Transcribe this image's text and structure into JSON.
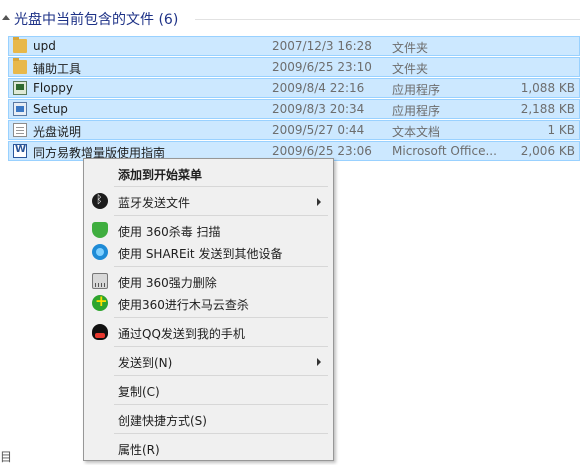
{
  "group": {
    "title": "光盘中当前包含的文件 (6)"
  },
  "files": [
    {
      "name": "upd",
      "date": "2007/12/3 16:28",
      "type": "文件夹",
      "size": "",
      "icon": "folder-icon"
    },
    {
      "name": "辅助工具",
      "date": "2009/6/25 23:10",
      "type": "文件夹",
      "size": "",
      "icon": "folder-icon"
    },
    {
      "name": "Floppy",
      "date": "2009/8/4 22:16",
      "type": "应用程序",
      "size": "1,088 KB",
      "icon": "application-icon"
    },
    {
      "name": "Setup",
      "date": "2009/8/3 20:34",
      "type": "应用程序",
      "size": "2,188 KB",
      "icon": "setup-icon"
    },
    {
      "name": "光盘说明",
      "date": "2009/5/27 0:44",
      "type": "文本文档",
      "size": "1 KB",
      "icon": "text-document-icon"
    },
    {
      "name": "同方易教增量版使用指南",
      "date": "2009/6/25 23:06",
      "type": "Microsoft Office...",
      "size": "2,006 KB",
      "icon": "word-document-icon"
    }
  ],
  "menu": {
    "pin_start": "添加到开始菜单",
    "bluetooth": "蓝牙发送文件",
    "scan_360": "使用 360杀毒 扫描",
    "shareit": "使用 SHAREit 发送到其他设备",
    "shred_360": "使用 360强力删除",
    "trojan_360": "使用360进行木马云查杀",
    "qq_send": "通过QQ发送到我的手机",
    "send_to": "发送到(N)",
    "copy": "复制(C)",
    "shortcut": "创建快捷方式(S)",
    "properties": "属性(R)"
  },
  "bottom_fragment": "目",
  "colors": {
    "selection_bg": "#cce8ff",
    "selection_border": "#99d1ff",
    "group_title": "#1e3287"
  }
}
